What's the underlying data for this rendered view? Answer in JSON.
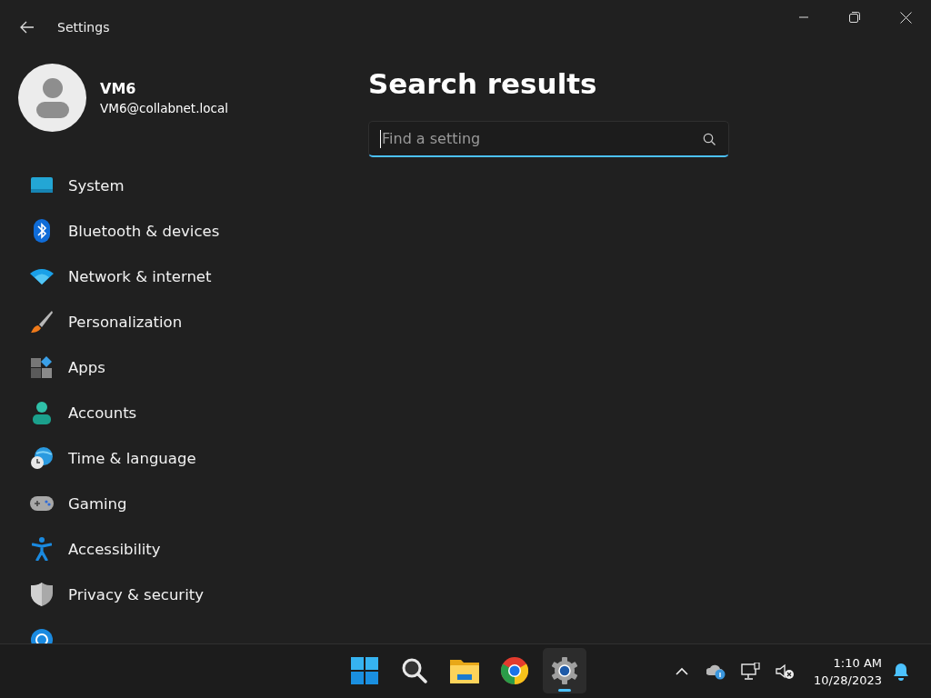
{
  "window": {
    "title": "Settings"
  },
  "user": {
    "name": "VM6",
    "email": "VM6@collabnet.local"
  },
  "nav": [
    {
      "kind": "system",
      "label": "System"
    },
    {
      "kind": "bluetooth",
      "label": "Bluetooth & devices"
    },
    {
      "kind": "network",
      "label": "Network & internet"
    },
    {
      "kind": "brush",
      "label": "Personalization"
    },
    {
      "kind": "apps",
      "label": "Apps"
    },
    {
      "kind": "accounts",
      "label": "Accounts"
    },
    {
      "kind": "time",
      "label": "Time & language"
    },
    {
      "kind": "gaming",
      "label": "Gaming"
    },
    {
      "kind": "accessibility",
      "label": "Accessibility"
    },
    {
      "kind": "privacy",
      "label": "Privacy & security"
    },
    {
      "kind": "update"
    }
  ],
  "page": {
    "heading": "Search results",
    "search": {
      "placeholder": "Find a setting"
    }
  },
  "taskbar": {
    "apps": [
      {
        "kind": "start",
        "selected": false
      },
      {
        "kind": "search",
        "selected": false
      },
      {
        "kind": "explorer",
        "selected": false
      },
      {
        "kind": "chrome",
        "selected": false
      },
      {
        "kind": "settings",
        "selected": true
      }
    ],
    "time": "1:10 AM",
    "date": "10/28/2023"
  }
}
